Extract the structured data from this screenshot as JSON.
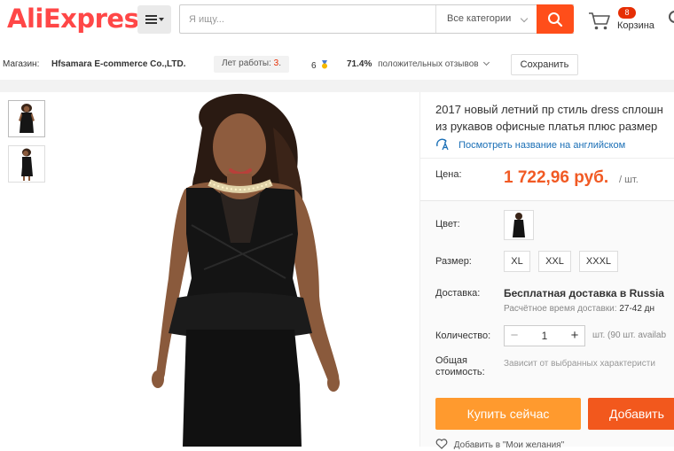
{
  "header": {
    "logo_part1": "Ali",
    "logo_part2": "Express",
    "logo_mark": "®",
    "search_placeholder": "Я ищу...",
    "category_select": "Все категории",
    "cart_count": "8",
    "cart_label": "Корзина"
  },
  "store": {
    "store_label": "Магазин:",
    "store_name": "Hfsamara E-commerce Co.,LTD.",
    "years_label": "Лет работы:",
    "years_value": "3",
    "years_suffix": ".",
    "rating_value": "6",
    "feedback_percent": "71.4%",
    "feedback_label": "положительных отзывов",
    "save_button": "Сохранить"
  },
  "product": {
    "title_line1": "2017 новый летний пр стиль dress сплошн",
    "title_line2": "из рукавов офисные платья плюс размер",
    "translate_link": "Посмотреть название на английском",
    "price_label": "Цена:",
    "price": "1 722,96 руб.",
    "price_unit": "/ шт.",
    "color_label": "Цвет:",
    "size_label": "Размер:",
    "sizes": [
      "XL",
      "XXL",
      "XXXL"
    ],
    "shipping_label": "Доставка:",
    "shipping_main": "Бесплатная доставка в Russia",
    "shipping_time_label": "Расчётное время доставки:",
    "shipping_time_value": "27-42 дн",
    "quantity_label": "Количество:",
    "quantity_minus": "−",
    "quantity_value": "1",
    "quantity_plus": "+",
    "availability": "шт. (90 шт. availab",
    "total_label_1": "Общая",
    "total_label_2": "стоимость:",
    "total_note": "Зависит от выбранных характеристи",
    "buy_now": "Купить сейчас",
    "add_to_cart": "Добавить",
    "wishlist": "Добавить в \"Мои желания\""
  },
  "colors": {
    "brand": "#ff4747",
    "search_button": "#ff4e1a",
    "price": "#f15a24",
    "buy_now": "#ff9a2e",
    "add_to_cart": "#f2581d",
    "link": "#1a6fb6"
  }
}
